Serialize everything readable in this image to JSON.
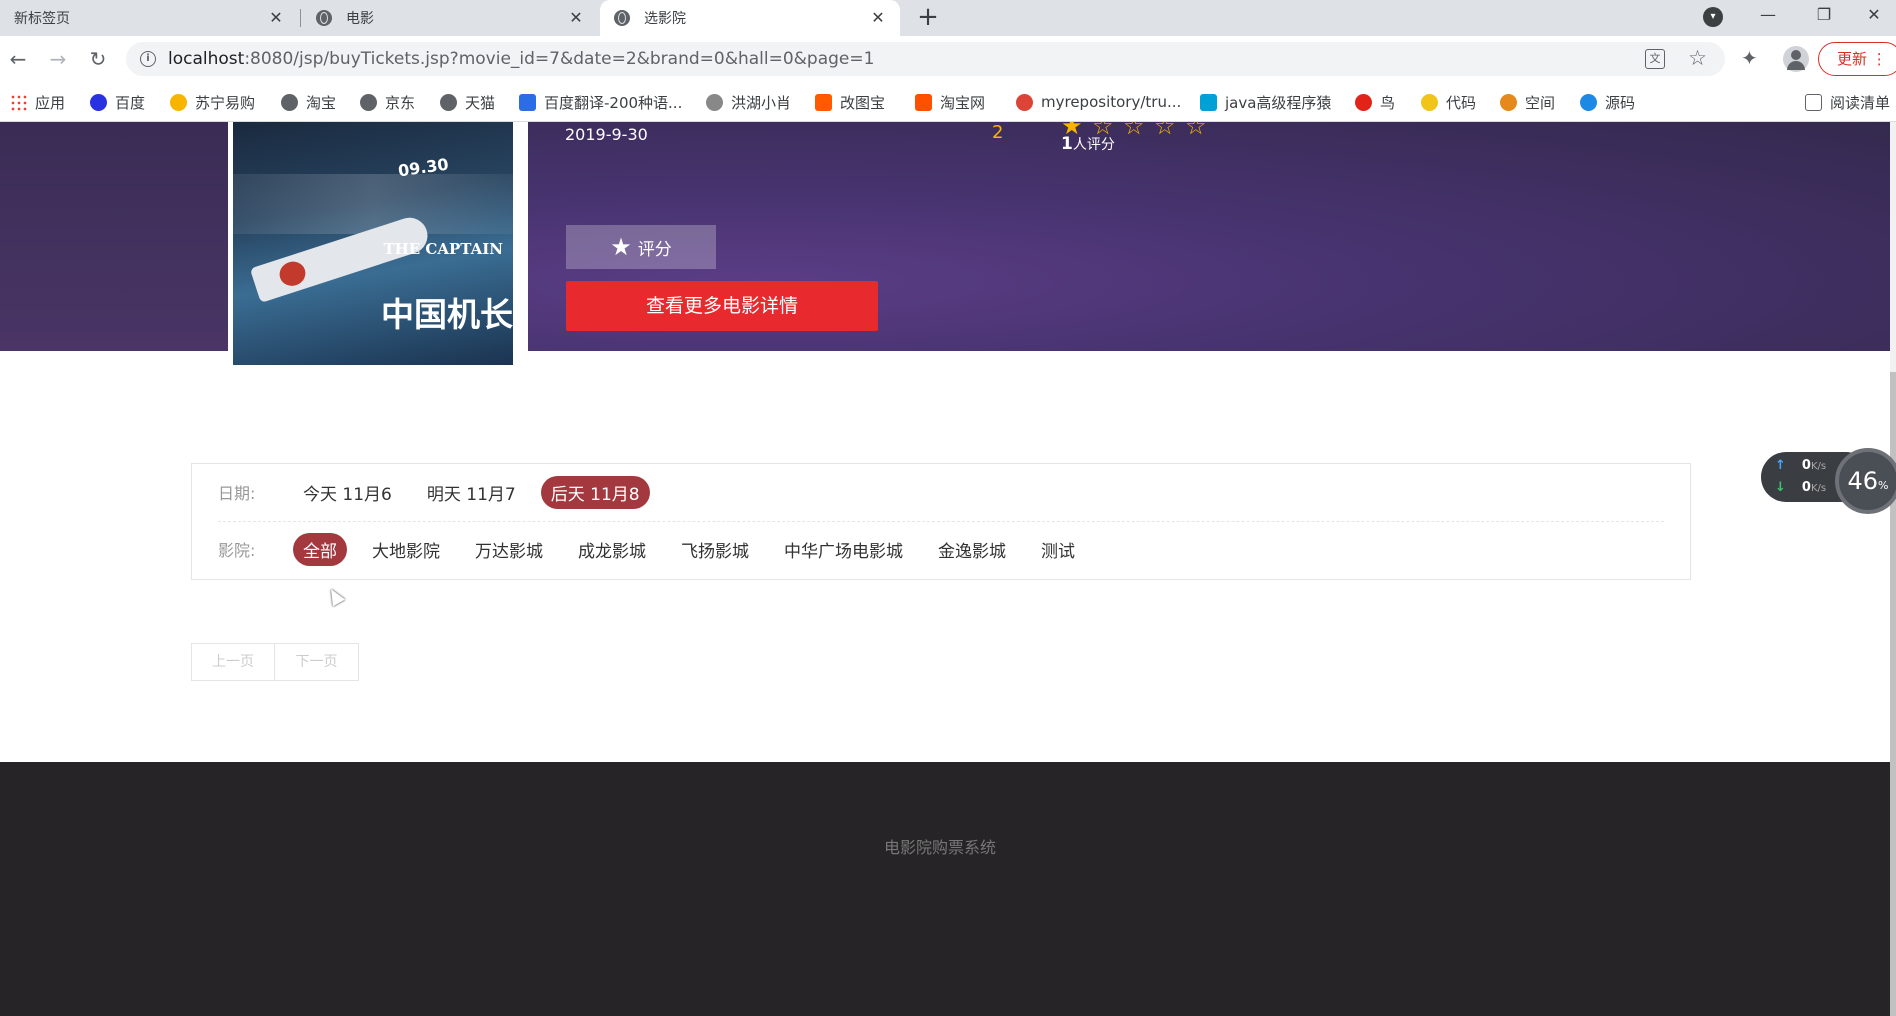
{
  "browser": {
    "tabs": [
      {
        "title": "新标签页",
        "active": false
      },
      {
        "title": "电影",
        "active": false
      },
      {
        "title": "选影院",
        "active": true
      }
    ],
    "url_host": "localhost",
    "url_rest": ":8080/jsp/buyTickets.jsp?movie_id=7&date=2&brand=0&hall=0&page=1",
    "update_label": "更新",
    "bookmarks": [
      {
        "label": "应用",
        "icon": "apps-grid-icon",
        "color": "#ea4335"
      },
      {
        "label": "百度",
        "icon": "baidu-paw-icon",
        "color": "#2932e1"
      },
      {
        "label": "苏宁易购",
        "icon": "suning-icon",
        "color": "#f7b500"
      },
      {
        "label": "淘宝",
        "icon": "globe-icon",
        "color": "#5f6368"
      },
      {
        "label": "京东",
        "icon": "globe-icon",
        "color": "#5f6368"
      },
      {
        "label": "天猫",
        "icon": "globe-icon",
        "color": "#5f6368"
      },
      {
        "label": "百度翻译-200种语...",
        "icon": "translate-icon",
        "color": "#2b6de5"
      },
      {
        "label": "洪湖小肖",
        "icon": "bird-icon",
        "color": "#888888"
      },
      {
        "label": "改图宝",
        "icon": "gaitubao-icon",
        "color": "#ff5a00"
      },
      {
        "label": "淘宝网",
        "icon": "taobao-icon",
        "color": "#ff5000"
      },
      {
        "label": "myrepository/tru...",
        "icon": "chrome-icon",
        "color": "#db4437"
      },
      {
        "label": "java高级程序猿",
        "icon": "bilibili-icon",
        "color": "#00a1d6"
      },
      {
        "label": "鸟",
        "icon": "bird-icon",
        "color": "#e2231a"
      },
      {
        "label": "代码",
        "icon": "code-icon",
        "color": "#f0c419"
      },
      {
        "label": "空间",
        "icon": "qzone-icon",
        "color": "#e6891c"
      },
      {
        "label": "源码",
        "icon": "fish-icon",
        "color": "#1e88e5"
      }
    ],
    "reading_list": "阅读清单"
  },
  "movie": {
    "poster_title_en": "THE CAPTAIN",
    "poster_title_cn": "中国机长",
    "poster_date": "09.30",
    "release_date": "2019-9-30",
    "rating_value": "2",
    "stars_filled": 1,
    "stars_total": 5,
    "rating_count_num": "1",
    "rating_count_suffix": "人评分",
    "rate_button": "评分",
    "more_details_button": "查看更多电影详情"
  },
  "filters": {
    "date_label": "日期:",
    "dates": [
      {
        "label": "今天 11月6",
        "active": false
      },
      {
        "label": "明天 11月7",
        "active": false
      },
      {
        "label": "后天 11月8",
        "active": true
      }
    ],
    "hall_label": "影院:",
    "halls": [
      {
        "label": "全部",
        "active": true
      },
      {
        "label": "大地影院",
        "active": false
      },
      {
        "label": "万达影城",
        "active": false
      },
      {
        "label": "成龙影城",
        "active": false
      },
      {
        "label": "飞扬影城",
        "active": false
      },
      {
        "label": "中华广场电影城",
        "active": false
      },
      {
        "label": "金逸影城",
        "active": false
      },
      {
        "label": "测试",
        "active": false
      }
    ]
  },
  "pager": {
    "prev": "上一页",
    "next": "下一页"
  },
  "footer": {
    "text": "电影院购票系统"
  },
  "net_widget": {
    "up_value": "0",
    "down_value": "0",
    "unit": "K/s",
    "percent": "46",
    "percent_sign": "%"
  },
  "colors": {
    "accent_red": "#e8292d",
    "chip_active": "#a3393e",
    "star": "#f7b500",
    "footer_bg": "#262426"
  }
}
